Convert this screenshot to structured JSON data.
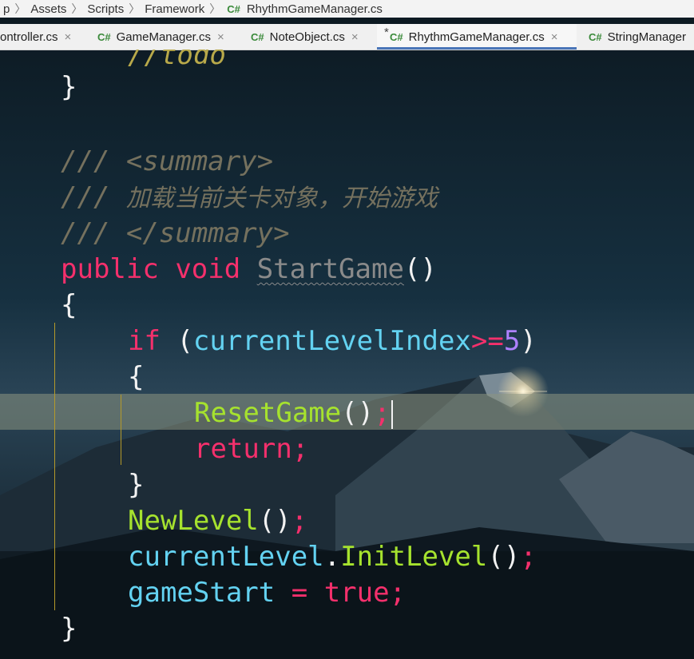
{
  "breadcrumb": {
    "items": [
      "p",
      "Assets",
      "Scripts",
      "Framework"
    ],
    "file_lang": "C#",
    "file": "RhythmGameManager.cs"
  },
  "tabs": [
    {
      "lang": "",
      "label": "ontroller.cs",
      "modified": "",
      "active": false
    },
    {
      "lang": "C#",
      "label": "GameManager.cs",
      "modified": "",
      "active": false
    },
    {
      "lang": "C#",
      "label": "NoteObject.cs",
      "modified": "",
      "active": false
    },
    {
      "lang": "C#",
      "label": "RhythmGameManager.cs",
      "modified": "*",
      "active": true
    },
    {
      "lang": "C#",
      "label": "StringManager",
      "modified": "",
      "active": false
    }
  ],
  "tab_close_glyph": "×",
  "code": {
    "todo": "//todo",
    "close_brace": "}",
    "doc_prefix": "/// ",
    "summary_open": "<summary>",
    "summary_text": "加载当前关卡对象，开始游戏",
    "summary_close": "</summary>",
    "kw_public": "public",
    "kw_void": "void",
    "method_name": "StartGame",
    "parens": "()",
    "open_brace": "{",
    "kw_if": "if",
    "paren_open": "(",
    "var_level_index": "currentLevelIndex",
    "op_ge": ">=",
    "num_5": "5",
    "paren_close": ")",
    "call_reset": "ResetGame",
    "semicolon": ";",
    "kw_return": "return",
    "call_newlevel": "NewLevel",
    "var_current_level": "currentLevel",
    "dot": ".",
    "call_initlevel": "InitLevel",
    "var_game_start": "gameStart",
    "op_assign": "=",
    "kw_true": "true"
  },
  "colors": {
    "keyword": "#f4306c",
    "function": "#a6e22e",
    "variable": "#63d2f1",
    "number": "#ae81ff",
    "comment": "#75715e",
    "doc_tag": "#e6db74",
    "active_tab_underline": "#4a76b8",
    "current_line": "#8c9682"
  }
}
